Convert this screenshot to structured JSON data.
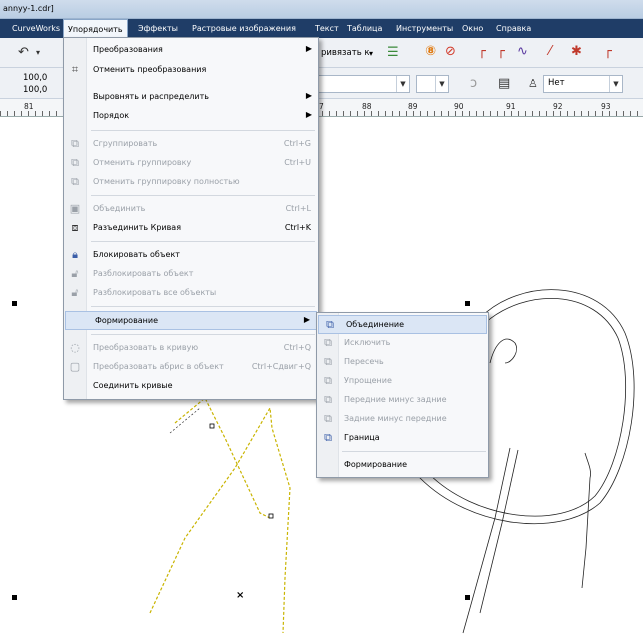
{
  "window": {
    "title": "annyy-1.cdr]"
  },
  "menubar": {
    "items": [
      "CurveWorks",
      "Упорядочить",
      "Эффекты",
      "Растровые изображения",
      "Текст",
      "Таблица",
      "Инструменты",
      "Окно",
      "Справка"
    ]
  },
  "toolbar": {
    "snap_label": "ривязать к",
    "x_value": "100,0",
    "y_value": "100,0",
    "outline_value": "Нет"
  },
  "ruler": {
    "labels": [
      "81",
      "7",
      "88",
      "89",
      "90",
      "91",
      "92",
      "93"
    ]
  },
  "menu": {
    "items": [
      {
        "label": "Преобразования",
        "shortcut": "",
        "submenu": true,
        "enabled": true,
        "icon": ""
      },
      {
        "label": "Отменить преобразования",
        "shortcut": "",
        "submenu": false,
        "enabled": true,
        "icon": "clear-transform-icon"
      },
      {
        "label": "Выровнять и распределить",
        "shortcut": "",
        "submenu": true,
        "enabled": true,
        "icon": ""
      },
      {
        "label": "Порядок",
        "shortcut": "",
        "submenu": true,
        "enabled": true,
        "icon": ""
      },
      {
        "label": "Сгруппировать",
        "shortcut": "Ctrl+G",
        "submenu": false,
        "enabled": false,
        "icon": "group-icon"
      },
      {
        "label": "Отменить группировку",
        "shortcut": "Ctrl+U",
        "submenu": false,
        "enabled": false,
        "icon": "ungroup-icon"
      },
      {
        "label": "Отменить группировку полностью",
        "shortcut": "",
        "submenu": false,
        "enabled": false,
        "icon": "ungroup-all-icon"
      },
      {
        "label": "Объединить",
        "shortcut": "Ctrl+L",
        "submenu": false,
        "enabled": false,
        "icon": "combine-icon"
      },
      {
        "label": "Разъединить Кривая",
        "shortcut": "Ctrl+K",
        "submenu": false,
        "enabled": true,
        "icon": "break-apart-icon"
      },
      {
        "label": "Блокировать объект",
        "shortcut": "",
        "submenu": false,
        "enabled": true,
        "icon": "lock-icon"
      },
      {
        "label": "Разблокировать объект",
        "shortcut": "",
        "submenu": false,
        "enabled": false,
        "icon": "unlock-icon"
      },
      {
        "label": "Разблокировать все объекты",
        "shortcut": "",
        "submenu": false,
        "enabled": false,
        "icon": "unlock-all-icon"
      },
      {
        "label": "Формирование",
        "shortcut": "",
        "submenu": true,
        "enabled": true,
        "icon": "",
        "highlighted": true
      },
      {
        "label": "Преобразовать в кривую",
        "shortcut": "Ctrl+Q",
        "submenu": false,
        "enabled": false,
        "icon": "convert-curve-icon"
      },
      {
        "label": "Преобразовать абрис в объект",
        "shortcut": "Ctrl+Сдвиг+Q",
        "submenu": false,
        "enabled": false,
        "icon": "outline-to-object-icon"
      },
      {
        "label": "Соединить кривые",
        "shortcut": "",
        "submenu": false,
        "enabled": true,
        "icon": ""
      }
    ]
  },
  "submenu": {
    "items": [
      {
        "label": "Объединение",
        "enabled": true,
        "highlighted": true,
        "icon": "weld-icon"
      },
      {
        "label": "Исключить",
        "enabled": false,
        "icon": "trim-icon"
      },
      {
        "label": "Пересечь",
        "enabled": false,
        "icon": "intersect-icon"
      },
      {
        "label": "Упрощение",
        "enabled": false,
        "icon": "simplify-icon"
      },
      {
        "label": "Передние минус задние",
        "enabled": false,
        "icon": "front-minus-back-icon"
      },
      {
        "label": "Задние минус передние",
        "enabled": false,
        "icon": "back-minus-front-icon"
      },
      {
        "label": "Граница",
        "enabled": true,
        "icon": "boundary-icon"
      },
      {
        "label": "Формирование",
        "enabled": true,
        "icon": ""
      }
    ]
  }
}
